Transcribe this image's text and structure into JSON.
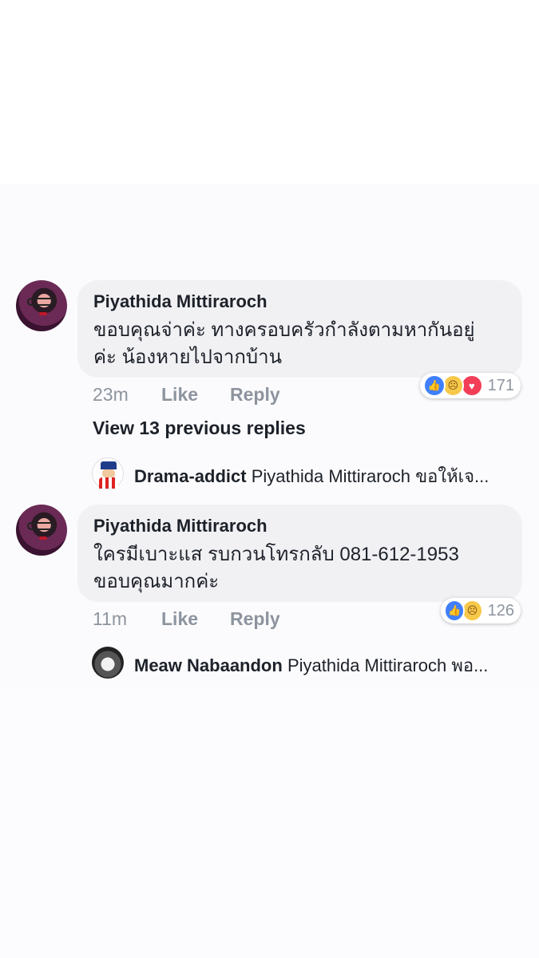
{
  "comments": [
    {
      "author": "Piyathida Mittiraroch",
      "text_line1": "ขอบคุณจ่าค่ะ ทางครอบครัวกำลังตามหากันอยู่",
      "text_line2": "ค่ะ น้องหายไปจากบ้าน",
      "time": "23m",
      "like_label": "Like",
      "reply_label": "Reply",
      "reaction_count": "171",
      "reactions": [
        "like-icon",
        "sad-icon",
        "love-icon"
      ]
    },
    {
      "author": "Piyathida Mittiraroch",
      "text_line1": "ใครมีเบาะแส รบกวนโทรกลับ 081-612-1953",
      "text_line2": "ขอบคุณมากค่ะ",
      "time": "11m",
      "like_label": "Like",
      "reply_label": "Reply",
      "reaction_count": "126",
      "reactions": [
        "like-icon",
        "sad-icon"
      ]
    }
  ],
  "view_previous": "View 13 previous replies",
  "replies": [
    {
      "author": "Drama-addict",
      "text": "Piyathida Mittiraroch ขอให้เจ..."
    },
    {
      "author": "Meaw Nabaandon",
      "text": "Piyathida Mittiraroch พอ..."
    }
  ]
}
